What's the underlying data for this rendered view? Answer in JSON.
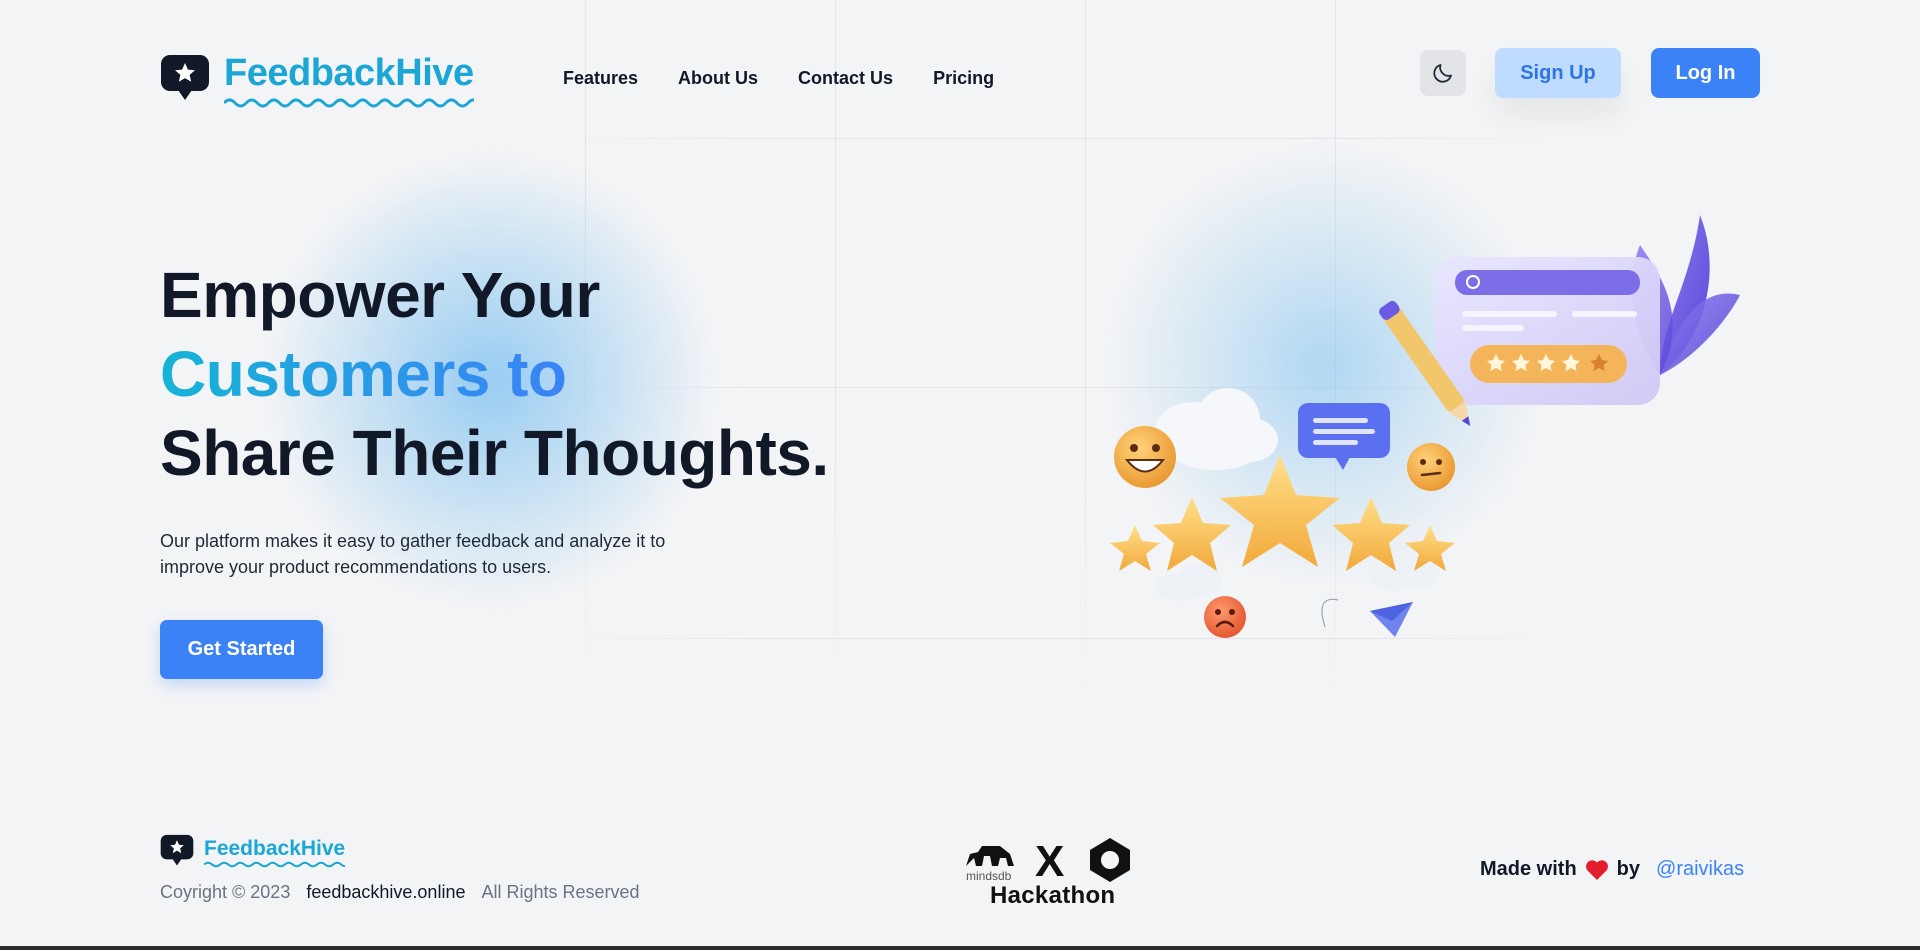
{
  "brand": {
    "name": "FeedbackHive"
  },
  "nav": [
    {
      "label": "Features"
    },
    {
      "label": "About Us"
    },
    {
      "label": "Contact Us"
    },
    {
      "label": "Pricing"
    }
  ],
  "header": {
    "theme_toggle_icon": "moon-icon",
    "signup_label": "Sign Up",
    "login_label": "Log In"
  },
  "hero": {
    "title_line1": "Empower Your",
    "title_line2": "Customers to",
    "title_line3": "Share Their Thoughts.",
    "description_line1": "Our platform makes it easy to gather feedback and analyze it to",
    "description_line2": "improve your product recommendations to users.",
    "cta_label": "Get Started"
  },
  "footer": {
    "copyright": "Coyright © 2023",
    "site": "feedbackhive.online",
    "rights": "All Rights Reserved",
    "hackathon_small": "mindsdb",
    "hackathon_x": "X",
    "hackathon_label": "Hackathon",
    "made_with": "Made with",
    "by": "by",
    "handle": "@raivikas"
  },
  "colors": {
    "primary": "#3b82f6",
    "brand_cyan": "#1ba6d6",
    "background": "#f3f4f6",
    "text_dark": "#111827"
  }
}
